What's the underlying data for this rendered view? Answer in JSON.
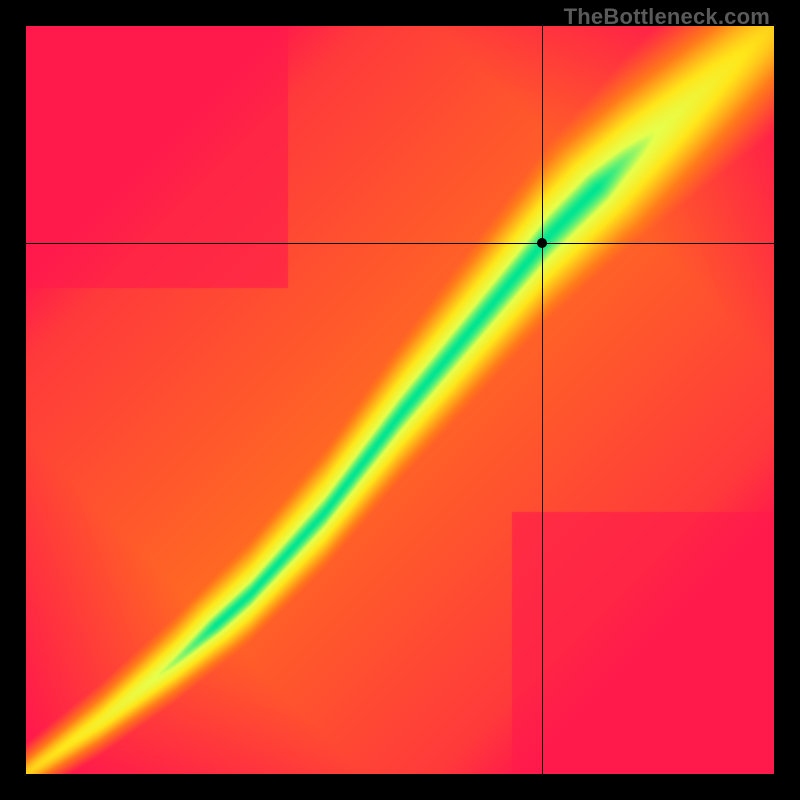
{
  "watermark": "TheBottleneck.com",
  "chart_data": {
    "type": "heatmap",
    "title": "",
    "xlabel": "",
    "ylabel": "",
    "xlim": [
      0,
      1
    ],
    "ylim": [
      0,
      1
    ],
    "grid": false,
    "legend": false,
    "marker": {
      "x": 0.69,
      "y": 0.71
    },
    "crosshair": {
      "x": 0.69,
      "y": 0.71
    },
    "optimal_curve": [
      {
        "x": 0.0,
        "y": 0.0
      },
      {
        "x": 0.1,
        "y": 0.07
      },
      {
        "x": 0.2,
        "y": 0.15
      },
      {
        "x": 0.3,
        "y": 0.24
      },
      {
        "x": 0.4,
        "y": 0.35
      },
      {
        "x": 0.5,
        "y": 0.48
      },
      {
        "x": 0.6,
        "y": 0.6
      },
      {
        "x": 0.7,
        "y": 0.72
      },
      {
        "x": 0.8,
        "y": 0.82
      },
      {
        "x": 0.9,
        "y": 0.91
      },
      {
        "x": 1.0,
        "y": 1.0
      }
    ],
    "color_stops": [
      {
        "t": 0.0,
        "color": "#ff1a4b"
      },
      {
        "t": 0.4,
        "color": "#ff7a1a"
      },
      {
        "t": 0.7,
        "color": "#ffe61a"
      },
      {
        "t": 0.88,
        "color": "#e6ff4d"
      },
      {
        "t": 1.0,
        "color": "#00e592"
      }
    ],
    "band_tightness": 0.11
  }
}
